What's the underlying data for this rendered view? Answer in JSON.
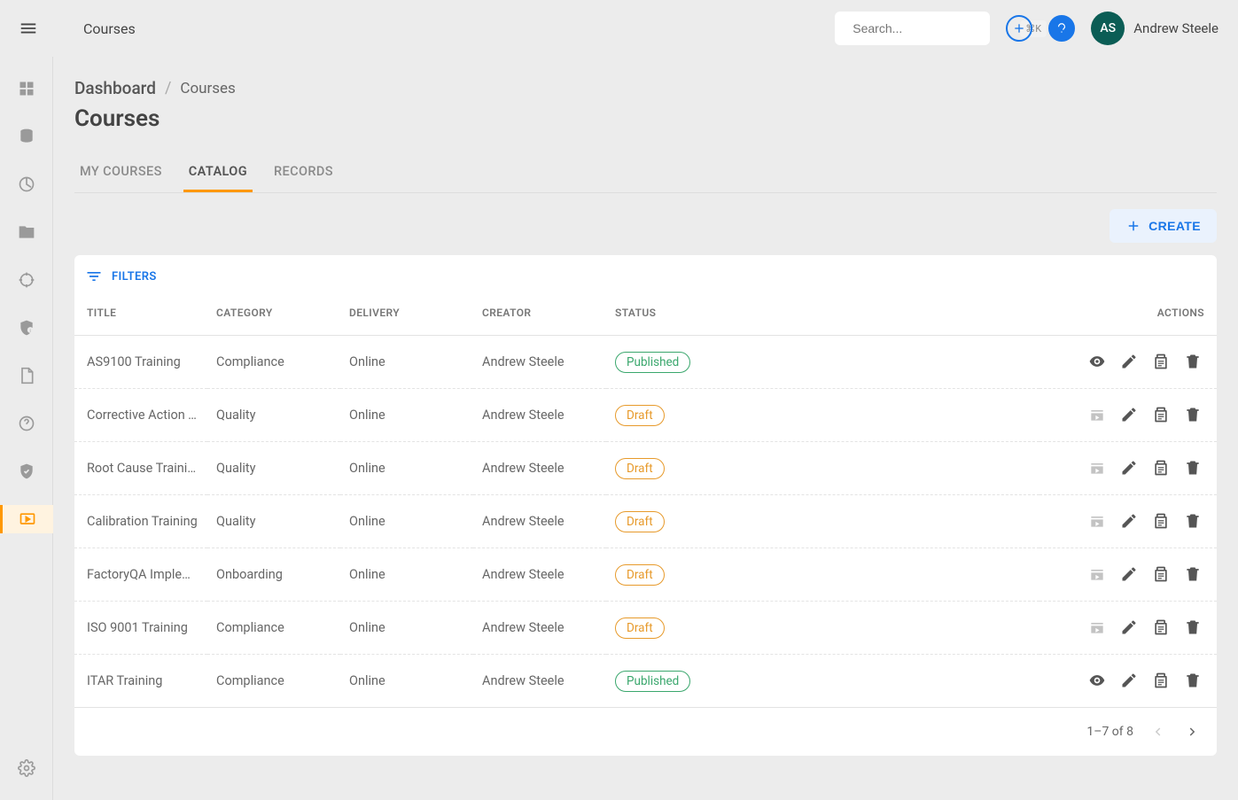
{
  "header": {
    "title": "Courses",
    "search_placeholder": "Search...",
    "search_kbd": "⌘K",
    "avatar_initials": "AS",
    "user_name": "Andrew Steele"
  },
  "breadcrumb": {
    "root": "Dashboard",
    "sep": "/",
    "current": "Courses"
  },
  "page_title": "Courses",
  "tabs": [
    {
      "label": "MY COURSES",
      "active": false
    },
    {
      "label": "CATALOG",
      "active": true
    },
    {
      "label": "RECORDS",
      "active": false
    }
  ],
  "create_label": "CREATE",
  "filters_label": "FILTERS",
  "columns": {
    "title": "TITLE",
    "category": "CATEGORY",
    "delivery": "DELIVERY",
    "creator": "CREATOR",
    "status": "STATUS",
    "actions": "ACTIONS"
  },
  "rows": [
    {
      "title": "AS9100 Training",
      "category": "Compliance",
      "delivery": "Online",
      "creator": "Andrew Steele",
      "status": "Published",
      "status_kind": "published",
      "first_action": "view"
    },
    {
      "title": "Corrective Action Tr…",
      "category": "Quality",
      "delivery": "Online",
      "creator": "Andrew Steele",
      "status": "Draft",
      "status_kind": "draft",
      "first_action": "publish"
    },
    {
      "title": "Root Cause Training",
      "category": "Quality",
      "delivery": "Online",
      "creator": "Andrew Steele",
      "status": "Draft",
      "status_kind": "draft",
      "first_action": "publish"
    },
    {
      "title": "Calibration Training",
      "category": "Quality",
      "delivery": "Online",
      "creator": "Andrew Steele",
      "status": "Draft",
      "status_kind": "draft",
      "first_action": "publish"
    },
    {
      "title": "FactoryQA Impleme…",
      "category": "Onboarding",
      "delivery": "Online",
      "creator": "Andrew Steele",
      "status": "Draft",
      "status_kind": "draft",
      "first_action": "publish"
    },
    {
      "title": "ISO 9001 Training",
      "category": "Compliance",
      "delivery": "Online",
      "creator": "Andrew Steele",
      "status": "Draft",
      "status_kind": "draft",
      "first_action": "publish"
    },
    {
      "title": "ITAR Training",
      "category": "Compliance",
      "delivery": "Online",
      "creator": "Andrew Steele",
      "status": "Published",
      "status_kind": "published",
      "first_action": "view"
    }
  ],
  "pagination": {
    "range": "1–7 of 8",
    "prev_enabled": false,
    "next_enabled": true
  }
}
